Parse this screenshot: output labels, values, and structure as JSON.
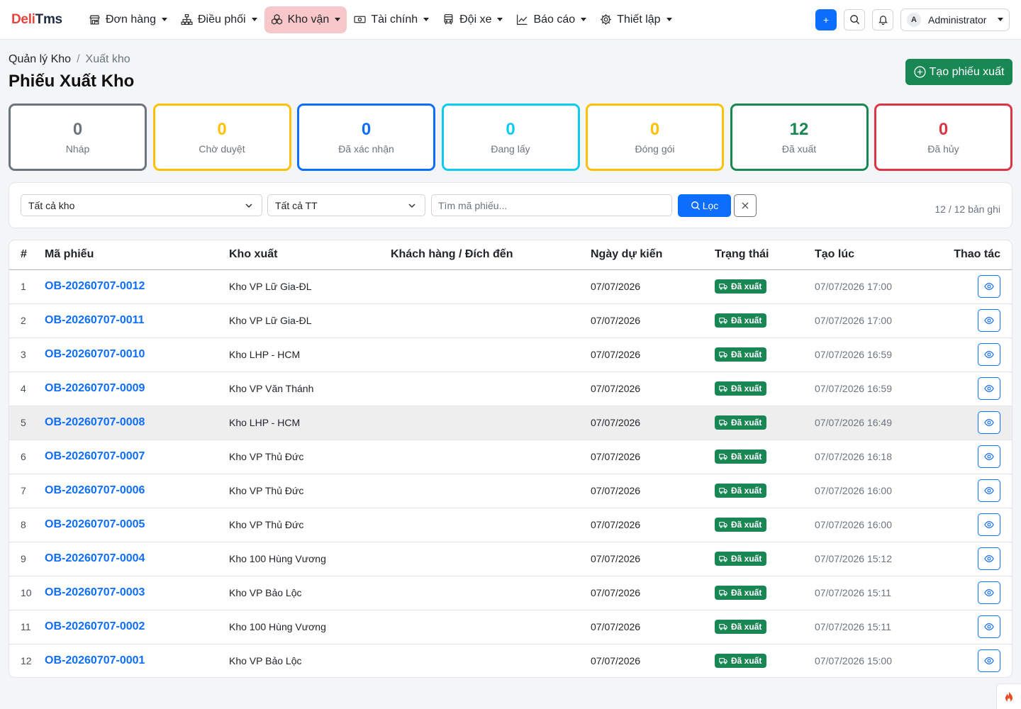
{
  "brand": {
    "part1": "Deli",
    "part2": "Tms"
  },
  "nav": {
    "items": [
      {
        "label": "Đơn hàng",
        "icon": "store-icon"
      },
      {
        "label": "Điều phối",
        "icon": "network-icon"
      },
      {
        "label": "Kho vận",
        "icon": "boxes-icon",
        "active": true
      },
      {
        "label": "Tài chính",
        "icon": "cash-icon"
      },
      {
        "label": "Đội xe",
        "icon": "bus-icon"
      },
      {
        "label": "Báo cáo",
        "icon": "chart-icon"
      },
      {
        "label": "Thiết lập",
        "icon": "gear-icon"
      }
    ],
    "plus_label": "+",
    "user": {
      "initial": "A",
      "name": "Administrator"
    }
  },
  "breadcrumb": {
    "parent": "Quản lý Kho",
    "separator": "/",
    "current": "Xuất kho"
  },
  "page_title": "Phiếu Xuất Kho",
  "create_button": "Tạo phiếu xuất",
  "stats": [
    {
      "value": "0",
      "label": "Nháp",
      "color": "#6c757d"
    },
    {
      "value": "0",
      "label": "Chờ duyệt",
      "color": "#ffc107"
    },
    {
      "value": "0",
      "label": "Đã xác nhận",
      "color": "#0d6efd"
    },
    {
      "value": "0",
      "label": "Đang lấy",
      "color": "#0dcaf0"
    },
    {
      "value": "0",
      "label": "Đóng gói",
      "color": "#ffc107"
    },
    {
      "value": "12",
      "label": "Đã xuất",
      "color": "#198754"
    },
    {
      "value": "0",
      "label": "Đã hủy",
      "color": "#dc3545"
    }
  ],
  "filters": {
    "warehouse": "Tất cả kho",
    "status": "Tất cả TT",
    "search_placeholder": "Tìm mã phiếu...",
    "search_value": "",
    "filter_button": "Lọc",
    "record_count": "12 / 12 bản ghi"
  },
  "table": {
    "headers": {
      "idx": "#",
      "code": "Mã phiếu",
      "warehouse": "Kho xuất",
      "customer": "Khách hàng / Đích đến",
      "date": "Ngày dự kiến",
      "status": "Trạng thái",
      "created": "Tạo lúc",
      "actions": "Thao tác"
    },
    "rows": [
      {
        "idx": "1",
        "code": "OB-20260707-0012",
        "warehouse": "Kho VP Lữ Gia-ĐL",
        "customer": "",
        "date": "07/07/2026",
        "status": "Đã xuất",
        "created": "07/07/2026 17:00"
      },
      {
        "idx": "2",
        "code": "OB-20260707-0011",
        "warehouse": "Kho VP Lữ Gia-ĐL",
        "customer": "",
        "date": "07/07/2026",
        "status": "Đã xuất",
        "created": "07/07/2026 17:00"
      },
      {
        "idx": "3",
        "code": "OB-20260707-0010",
        "warehouse": "Kho LHP - HCM",
        "customer": "",
        "date": "07/07/2026",
        "status": "Đã xuất",
        "created": "07/07/2026 16:59"
      },
      {
        "idx": "4",
        "code": "OB-20260707-0009",
        "warehouse": "Kho VP Văn Thánh",
        "customer": "",
        "date": "07/07/2026",
        "status": "Đã xuất",
        "created": "07/07/2026 16:59"
      },
      {
        "idx": "5",
        "code": "OB-20260707-0008",
        "warehouse": "Kho LHP - HCM",
        "customer": "",
        "date": "07/07/2026",
        "status": "Đã xuất",
        "created": "07/07/2026 16:49",
        "highlighted": true
      },
      {
        "idx": "6",
        "code": "OB-20260707-0007",
        "warehouse": "Kho VP Thủ Đức",
        "customer": "",
        "date": "07/07/2026",
        "status": "Đã xuất",
        "created": "07/07/2026 16:18"
      },
      {
        "idx": "7",
        "code": "OB-20260707-0006",
        "warehouse": "Kho VP Thủ Đức",
        "customer": "",
        "date": "07/07/2026",
        "status": "Đã xuất",
        "created": "07/07/2026 16:00"
      },
      {
        "idx": "8",
        "code": "OB-20260707-0005",
        "warehouse": "Kho VP Thủ Đức",
        "customer": "",
        "date": "07/07/2026",
        "status": "Đã xuất",
        "created": "07/07/2026 16:00"
      },
      {
        "idx": "9",
        "code": "OB-20260707-0004",
        "warehouse": "Kho 100 Hùng Vương",
        "customer": "",
        "date": "07/07/2026",
        "status": "Đã xuất",
        "created": "07/07/2026 15:12"
      },
      {
        "idx": "10",
        "code": "OB-20260707-0003",
        "warehouse": "Kho VP Bảo Lộc",
        "customer": "",
        "date": "07/07/2026",
        "status": "Đã xuất",
        "created": "07/07/2026 15:11"
      },
      {
        "idx": "11",
        "code": "OB-20260707-0002",
        "warehouse": "Kho 100 Hùng Vương",
        "customer": "",
        "date": "07/07/2026",
        "status": "Đã xuất",
        "created": "07/07/2026 15:11"
      },
      {
        "idx": "12",
        "code": "OB-20260707-0001",
        "warehouse": "Kho VP Bảo Lộc",
        "customer": "",
        "date": "07/07/2026",
        "status": "Đã xuất",
        "created": "07/07/2026 15:00"
      }
    ]
  },
  "colors": {
    "primary": "#0d6efd",
    "success": "#198754",
    "brand_red": "#e8453c",
    "active_nav_bg": "#f8c7c9"
  }
}
